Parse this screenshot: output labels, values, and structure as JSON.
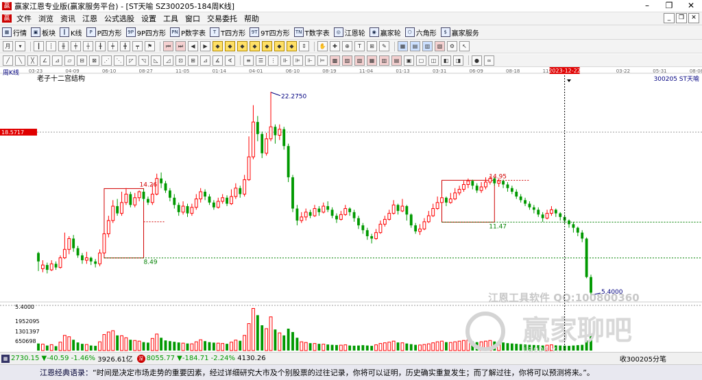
{
  "window": {
    "title": "赢家江恩专业版(赢家服务平台) - [ST天喻 SZ300205-184周K线]",
    "minimize": "–",
    "restore": "❐",
    "close": "✕"
  },
  "menu": [
    "文件",
    "浏览",
    "资讯",
    "江恩",
    "公式选股",
    "设置",
    "工具",
    "窗口",
    "交易委托",
    "帮助"
  ],
  "mdi_buttons": [
    "_",
    "❐",
    "✕"
  ],
  "toolbar1": [
    {
      "icon": "grid-icon",
      "label": "行情"
    },
    {
      "icon": "blocks-icon",
      "label": "板块"
    },
    {
      "icon": "candle-icon",
      "label": "K线"
    },
    {
      "icon": "p-icon",
      "label": "P四方形"
    },
    {
      "icon": "9p-icon",
      "label": "9P四方形"
    },
    {
      "icon": "pn-icon",
      "label": "P数字表"
    },
    {
      "icon": "t-icon",
      "label": "T四方形"
    },
    {
      "icon": "9t-icon",
      "label": "9T四方形"
    },
    {
      "icon": "tn-icon",
      "label": "T数字表"
    },
    {
      "icon": "wheel-icon",
      "label": "江恩轮"
    },
    {
      "icon": "win-wheel-icon",
      "label": "赢家轮"
    },
    {
      "icon": "hexagon-icon",
      "label": "六角形"
    },
    {
      "icon": "dollar-icon",
      "label": "赢家服务"
    }
  ],
  "chart": {
    "period_label": "周K线",
    "indicator_label": "老子十二宫结构",
    "stock_label": "300205 ST天喻",
    "top_dates": [
      "03-23",
      "04-09",
      "06-10",
      "08-27",
      "11-05",
      "01-14",
      "04-01",
      "06-10",
      "08-19",
      "11-04",
      "01-13",
      "03-31",
      "06-09",
      "08-18",
      "11-03",
      "2023-12-22",
      "03-22",
      "05-31",
      "08-08"
    ],
    "cursor_date": "2023-12-22",
    "price_tag": "18.5717",
    "labels": {
      "high": "22.2750",
      "box1_top": "14.26",
      "box1_bottom": "8.49",
      "box2_top": "14.95",
      "box2_bottom": "11.47",
      "last_low": "5.4000"
    },
    "volume_axis": [
      "5.4000",
      "1952095",
      "1301397",
      "650698"
    ],
    "watermark_line1": "江恩工具软件  QQ:100800360",
    "watermark_line2": "赢家聊吧",
    "watermark_url": "jiaoba.yi..."
  },
  "status": {
    "sh_index": "2730.15",
    "sh_change": "▼-40.59",
    "sh_pct": "-1.46%",
    "sh_amount": "3926.61亿",
    "sz_index": "8055.77",
    "sz_change": "▼-184.71",
    "sz_pct": "-2.24%",
    "sz_amount": "4130.26",
    "right_text": "收300205分笔"
  },
  "quote_prefix": "江恩经典语录：",
  "quote": "“时间是决定市场走势的重要因素，经过详细研究大市及个别股票的过往记录，你将可以证明，历史确实重复发生；而了解过往，你将可以预测将来。”。",
  "colors": {
    "up": "#ff0000",
    "down": "#009900",
    "box": "#d00000"
  },
  "chart_data": {
    "type": "candlestick",
    "period": "weekly",
    "ylim": [
      5.0,
      23.0
    ],
    "volume_ylim": [
      0,
      2600000
    ],
    "candles": [
      [
        8.9,
        8.2,
        9.0,
        7.4
      ],
      [
        7.6,
        7.9,
        8.3,
        7.3
      ],
      [
        7.9,
        7.5,
        8.1,
        7.2
      ],
      [
        7.5,
        8.0,
        8.3,
        7.4
      ],
      [
        8.0,
        7.7,
        8.2,
        7.5
      ],
      [
        7.7,
        8.5,
        8.7,
        7.6
      ],
      [
        8.5,
        9.2,
        10.6,
        8.4
      ],
      [
        9.2,
        10.1,
        10.3,
        8.8
      ],
      [
        10.1,
        9.3,
        10.4,
        9.0
      ],
      [
        9.3,
        8.7,
        9.5,
        8.5
      ],
      [
        8.7,
        8.3,
        8.9,
        8.0
      ],
      [
        8.3,
        8.5,
        9.0,
        8.0
      ],
      [
        8.5,
        8.2,
        8.6,
        7.9
      ],
      [
        8.2,
        8.0,
        8.4,
        7.7
      ],
      [
        8.0,
        8.9,
        9.2,
        7.8
      ],
      [
        8.9,
        10.5,
        10.8,
        8.8
      ],
      [
        10.5,
        11.6,
        12.0,
        10.2
      ],
      [
        11.6,
        12.8,
        13.3,
        11.4
      ],
      [
        12.8,
        12.2,
        13.4,
        12.0
      ],
      [
        12.2,
        13.1,
        14.0,
        12.0
      ],
      [
        13.1,
        13.8,
        14.3,
        12.9
      ],
      [
        13.8,
        12.9,
        14.0,
        12.7
      ],
      [
        12.9,
        13.5,
        13.9,
        12.7
      ],
      [
        13.5,
        14.0,
        14.1,
        13.2
      ],
      [
        14.0,
        13.4,
        14.2,
        13.2
      ],
      [
        13.4,
        13.1,
        13.6,
        12.9
      ],
      [
        13.1,
        13.8,
        14.6,
        12.9
      ],
      [
        13.8,
        15.1,
        15.5,
        13.7
      ],
      [
        15.1,
        14.7,
        15.6,
        14.3
      ],
      [
        14.7,
        14.1,
        14.9,
        13.9
      ],
      [
        14.1,
        13.5,
        14.3,
        13.2
      ],
      [
        13.5,
        12.9,
        13.8,
        12.6
      ],
      [
        12.9,
        12.3,
        13.1,
        12.0
      ],
      [
        12.3,
        12.8,
        13.2,
        12.1
      ],
      [
        12.8,
        12.2,
        13.0,
        11.9
      ],
      [
        12.2,
        12.7,
        13.0,
        12.0
      ],
      [
        12.7,
        13.4,
        13.8,
        12.5
      ],
      [
        13.4,
        14.0,
        14.3,
        13.1
      ],
      [
        14.0,
        13.6,
        14.2,
        13.3
      ],
      [
        13.6,
        13.1,
        13.8,
        12.9
      ],
      [
        13.1,
        12.7,
        13.3,
        12.5
      ],
      [
        12.7,
        13.2,
        13.5,
        12.6
      ],
      [
        13.2,
        13.5,
        13.8,
        13.0
      ],
      [
        13.5,
        13.0,
        13.7,
        12.8
      ],
      [
        13.0,
        13.6,
        14.2,
        12.9
      ],
      [
        13.6,
        14.3,
        14.7,
        13.4
      ],
      [
        14.3,
        13.8,
        14.5,
        13.5
      ],
      [
        13.8,
        15.0,
        15.4,
        13.6
      ],
      [
        15.0,
        16.9,
        18.6,
        14.9
      ],
      [
        16.9,
        19.8,
        21.2,
        16.7
      ],
      [
        19.8,
        18.8,
        20.3,
        18.2
      ],
      [
        18.8,
        17.2,
        19.0,
        16.8
      ],
      [
        17.2,
        18.4,
        18.9,
        17.0
      ],
      [
        18.4,
        19.4,
        22.3,
        18.2
      ],
      [
        19.4,
        18.7,
        19.6,
        18.0
      ],
      [
        18.7,
        19.2,
        19.6,
        18.3
      ],
      [
        19.2,
        17.8,
        19.4,
        17.5
      ],
      [
        17.8,
        15.2,
        18.0,
        14.8
      ],
      [
        15.2,
        12.6,
        15.4,
        12.3
      ],
      [
        12.6,
        11.6,
        12.9,
        11.2
      ],
      [
        11.6,
        11.9,
        12.3,
        11.4
      ],
      [
        11.9,
        12.3,
        12.6,
        11.6
      ],
      [
        12.3,
        12.0,
        12.5,
        11.8
      ],
      [
        12.0,
        12.6,
        12.9,
        11.9
      ],
      [
        12.6,
        12.3,
        12.8,
        12.0
      ],
      [
        12.3,
        12.8,
        13.1,
        12.2
      ],
      [
        12.8,
        12.5,
        13.2,
        12.3
      ],
      [
        12.5,
        12.0,
        12.7,
        11.8
      ],
      [
        12.0,
        11.7,
        12.2,
        11.4
      ],
      [
        11.7,
        12.1,
        12.4,
        11.6
      ],
      [
        12.1,
        12.6,
        12.9,
        12.0
      ],
      [
        12.6,
        12.3,
        12.7,
        12.0
      ],
      [
        12.3,
        11.8,
        12.5,
        11.5
      ],
      [
        11.8,
        11.2,
        12.0,
        10.9
      ],
      [
        11.2,
        10.8,
        11.4,
        10.5
      ],
      [
        10.8,
        10.3,
        11.0,
        10.0
      ],
      [
        10.3,
        10.1,
        10.5,
        9.7
      ],
      [
        10.1,
        10.6,
        10.9,
        10.0
      ],
      [
        10.6,
        11.3,
        11.6,
        10.5
      ],
      [
        11.3,
        11.7,
        12.0,
        11.1
      ],
      [
        11.7,
        12.2,
        12.5,
        11.6
      ],
      [
        12.2,
        12.9,
        13.3,
        12.1
      ],
      [
        12.9,
        12.4,
        13.0,
        12.1
      ],
      [
        12.4,
        12.8,
        13.4,
        12.3
      ],
      [
        12.8,
        12.1,
        12.9,
        11.6
      ],
      [
        12.1,
        11.2,
        12.2,
        11.0
      ],
      [
        11.2,
        10.7,
        11.4,
        10.5
      ],
      [
        10.7,
        10.9,
        11.3,
        10.4
      ],
      [
        10.9,
        11.5,
        11.8,
        10.8
      ],
      [
        11.5,
        12.0,
        12.4,
        11.4
      ],
      [
        12.0,
        12.6,
        13.0,
        11.9
      ],
      [
        12.6,
        13.1,
        13.6,
        12.5
      ],
      [
        13.1,
        13.5,
        13.8,
        12.9
      ],
      [
        13.5,
        13.1,
        13.6,
        12.8
      ],
      [
        13.1,
        13.4,
        13.9,
        13.0
      ],
      [
        13.4,
        13.9,
        14.3,
        13.3
      ],
      [
        13.9,
        14.2,
        14.5,
        13.7
      ],
      [
        14.2,
        14.6,
        14.9,
        14.0
      ],
      [
        14.6,
        14.9,
        15.1,
        14.3
      ],
      [
        14.9,
        14.5,
        15.0,
        14.2
      ],
      [
        14.5,
        14.1,
        14.7,
        13.9
      ],
      [
        14.1,
        14.4,
        14.8,
        13.9
      ],
      [
        14.4,
        14.8,
        15.2,
        14.2
      ],
      [
        14.8,
        15.1,
        15.3,
        14.6
      ],
      [
        15.1,
        14.7,
        15.2,
        14.5
      ],
      [
        14.7,
        14.9,
        15.1,
        14.4
      ],
      [
        14.9,
        14.6,
        15.0,
        14.3
      ],
      [
        14.6,
        14.3,
        14.8,
        14.0
      ],
      [
        14.3,
        14.0,
        14.5,
        13.8
      ],
      [
        14.0,
        13.6,
        14.2,
        13.4
      ],
      [
        13.6,
        13.3,
        13.8,
        13.1
      ],
      [
        13.3,
        13.0,
        13.5,
        12.8
      ],
      [
        13.0,
        12.7,
        13.2,
        12.5
      ],
      [
        12.7,
        12.5,
        12.9,
        12.2
      ],
      [
        12.5,
        12.1,
        12.7,
        11.9
      ],
      [
        12.1,
        11.8,
        12.3,
        11.5
      ],
      [
        11.8,
        12.2,
        12.5,
        11.7
      ],
      [
        12.2,
        12.5,
        12.8,
        12.0
      ],
      [
        12.5,
        12.2,
        12.6,
        11.9
      ],
      [
        12.2,
        11.9,
        12.3,
        11.6
      ],
      [
        11.9,
        11.6,
        12.1,
        11.3
      ],
      [
        11.6,
        11.3,
        11.7,
        11.0
      ],
      [
        11.3,
        11.0,
        11.5,
        10.6
      ],
      [
        11.0,
        10.6,
        11.1,
        10.3
      ],
      [
        10.6,
        10.1,
        10.8,
        9.8
      ],
      [
        10.1,
        6.9,
        10.2,
        6.8
      ],
      [
        6.9,
        5.6,
        7.1,
        5.4
      ]
    ],
    "volume": [
      420000,
      380000,
      300000,
      350000,
      260000,
      500000,
      900000,
      820000,
      640000,
      480000,
      400000,
      360000,
      300000,
      280000,
      520000,
      950000,
      1100000,
      1180000,
      900000,
      880000,
      760000,
      640000,
      600000,
      560000,
      500000,
      470000,
      720000,
      980000,
      760000,
      600000,
      560000,
      520000,
      480000,
      440000,
      420000,
      400000,
      520000,
      640000,
      560000,
      500000,
      470000,
      440000,
      420000,
      400000,
      500000,
      620000,
      580000,
      900000,
      1600000,
      2500000,
      2100000,
      1500000,
      1300000,
      2000000,
      1250000,
      1050000,
      900000,
      1300000,
      1100000,
      760000,
      520000,
      480000,
      440000,
      420000,
      400000,
      380000,
      360000,
      340000,
      330000,
      320000,
      340000,
      300000,
      290000,
      300000,
      320000,
      300000,
      280000,
      340000,
      420000,
      460000,
      500000,
      560000,
      480000,
      460000,
      420000,
      380000,
      340000,
      330000,
      360000,
      400000,
      460000,
      520000,
      560000,
      500000,
      480000,
      520000,
      560000,
      600000,
      620000,
      540000,
      500000,
      520000,
      560000,
      600000,
      540000,
      500000,
      480000,
      440000,
      420000,
      400000,
      380000,
      360000,
      340000,
      330000,
      320000,
      300000,
      320000,
      340000,
      310000,
      300000,
      290000,
      280000,
      300000,
      320000,
      340000,
      600000,
      1000000
    ]
  }
}
